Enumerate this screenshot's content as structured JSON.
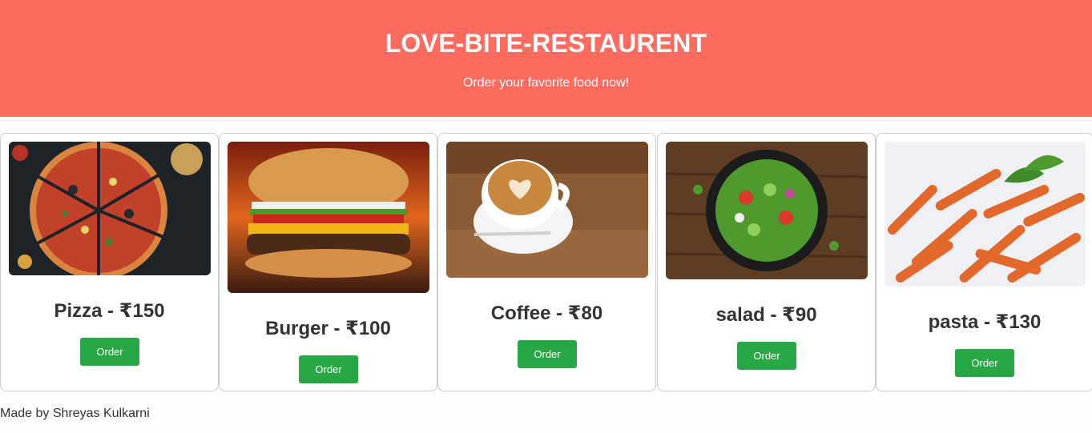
{
  "header": {
    "title": "LOVE-BITE-RESTAURENT",
    "subtitle": "Order your favorite food now!"
  },
  "menu": [
    {
      "name": "Pizza - ₹150",
      "button": "Order",
      "image": "pizza-image"
    },
    {
      "name": "Burger - ₹100",
      "button": "Order",
      "image": "burger-image"
    },
    {
      "name": "Coffee - ₹80",
      "button": "Order",
      "image": "coffee-image"
    },
    {
      "name": "salad - ₹90",
      "button": "Order",
      "image": "salad-image"
    },
    {
      "name": "pasta - ₹130",
      "button": "Order",
      "image": "pasta-image"
    }
  ],
  "footer": {
    "text": "Made by Shreyas Kulkarni"
  },
  "colors": {
    "header_bg": "#ff6b5e",
    "button_bg": "#28a745",
    "text": "#333333"
  }
}
